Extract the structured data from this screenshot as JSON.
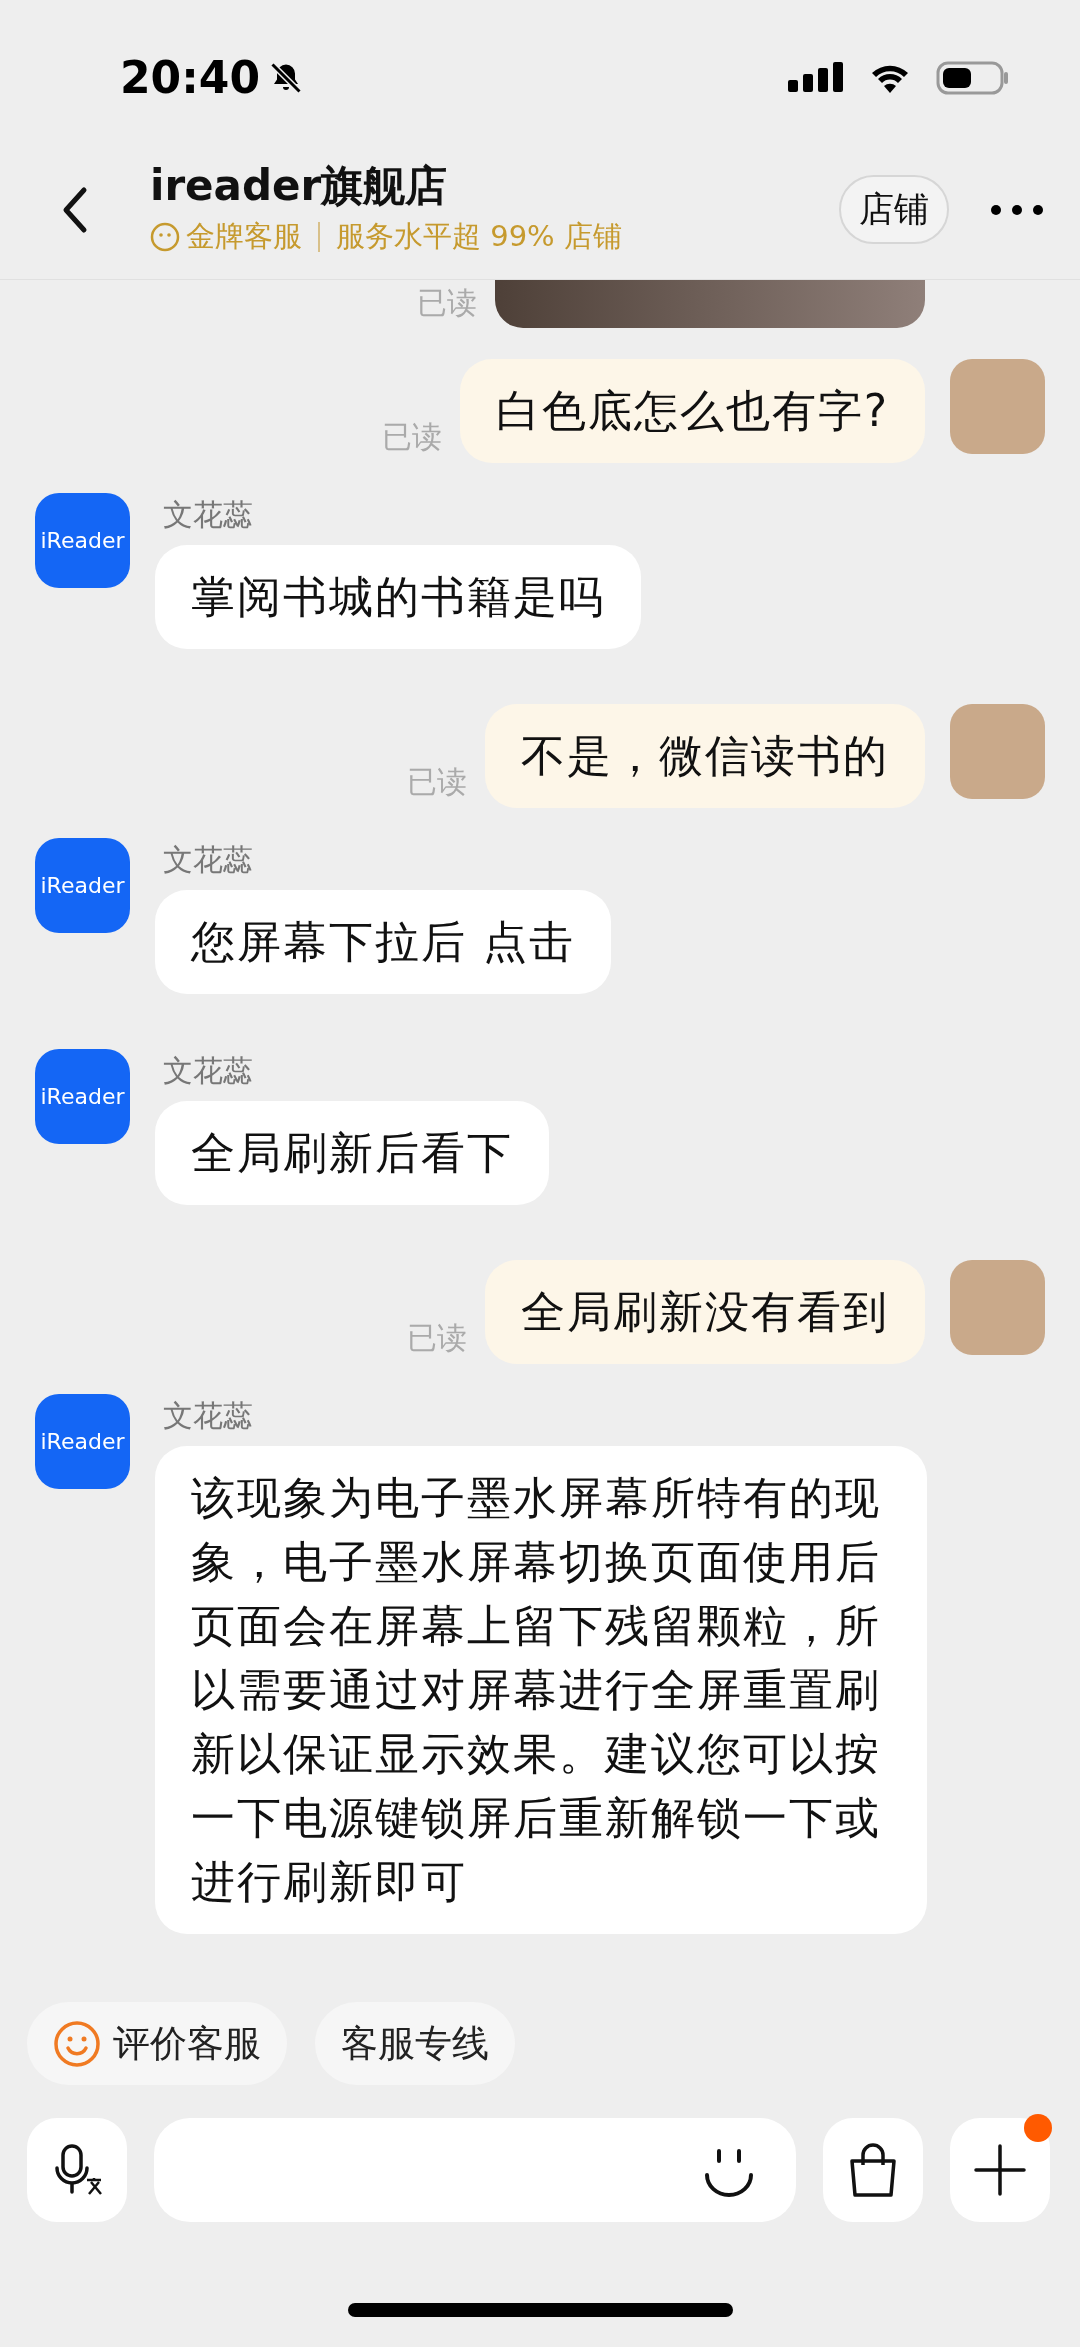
{
  "status_bar": {
    "time": "20:40"
  },
  "header": {
    "title": "ireader旗舰店",
    "badge": "金牌客服",
    "service": "服务水平超 99% 店铺",
    "shop_button": "店铺"
  },
  "messages": [
    {
      "kind": "image",
      "outgoing": true,
      "read_label": "已读"
    },
    {
      "kind": "text",
      "outgoing": true,
      "text": "白色底怎么也有字?",
      "read_label": "已读"
    },
    {
      "kind": "text",
      "outgoing": false,
      "sender": "文花蕊",
      "avatar_label": "iReader",
      "text": "掌阅书城的书籍是吗"
    },
    {
      "kind": "text",
      "outgoing": true,
      "text": "不是，微信读书的",
      "read_label": "已读"
    },
    {
      "kind": "text",
      "outgoing": false,
      "sender": "文花蕊",
      "avatar_label": "iReader",
      "text": "您屏幕下拉后 点击"
    },
    {
      "kind": "text",
      "outgoing": false,
      "sender": "文花蕊",
      "avatar_label": "iReader",
      "text": "全局刷新后看下"
    },
    {
      "kind": "text",
      "outgoing": true,
      "text": "全局刷新没有看到",
      "read_label": "已读"
    },
    {
      "kind": "text",
      "outgoing": false,
      "sender": "文花蕊",
      "avatar_label": "iReader",
      "text": "该现象为电子墨水屏幕所特有的现象，电子墨水屏幕切换页面使用后页面会在屏幕上留下残留颗粒，所以需要通过对屏幕进行全屏重置刷新以保证显示效果。建议您可以按一下电源键锁屏后重新解锁一下或进行刷新即可"
    }
  ],
  "quick_replies": [
    {
      "kind": "rate",
      "label": "评价客服"
    },
    {
      "kind": "plain",
      "label": "客服专线"
    }
  ],
  "input_bar": {
    "plus_dot": true
  }
}
